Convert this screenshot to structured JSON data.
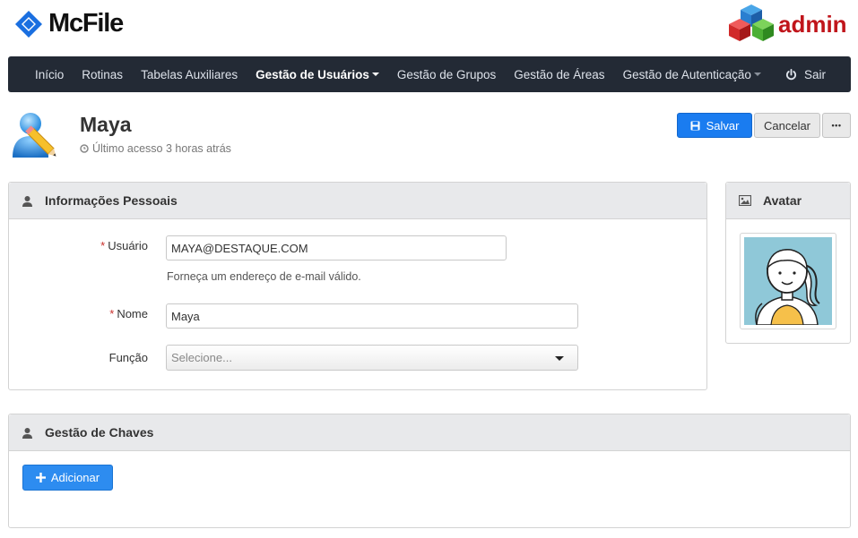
{
  "brand": {
    "name": "McFile",
    "admin_label": "admin"
  },
  "nav": {
    "items": [
      {
        "label": "Início",
        "active": false,
        "dropdown": false
      },
      {
        "label": "Rotinas",
        "active": false,
        "dropdown": false
      },
      {
        "label": "Tabelas Auxiliares",
        "active": false,
        "dropdown": false
      },
      {
        "label": "Gestão de Usuários",
        "active": true,
        "dropdown": true
      },
      {
        "label": "Gestão de Grupos",
        "active": false,
        "dropdown": false
      },
      {
        "label": "Gestão de Áreas",
        "active": false,
        "dropdown": false
      },
      {
        "label": "Gestão de Autenticação",
        "active": false,
        "dropdown": true
      }
    ],
    "logout_label": "Sair"
  },
  "user": {
    "name": "Maya",
    "last_access": "Último acesso 3 horas atrás"
  },
  "actions": {
    "save": "Salvar",
    "cancel": "Cancelar",
    "more": "•••"
  },
  "personal_panel": {
    "title": "Informações Pessoais",
    "required_mark": "*",
    "username_label": "Usuário",
    "username_value": "MAYA@DESTAQUE.COM",
    "username_help": "Forneça um endereço de e-mail válido.",
    "name_label": "Nome",
    "name_value": "Maya",
    "role_label": "Função",
    "role_placeholder": "Selecione..."
  },
  "avatar_panel": {
    "title": "Avatar"
  },
  "keys_panel": {
    "title": "Gestão de Chaves",
    "add_label": "Adicionar"
  },
  "colors": {
    "navbar": "#232a35",
    "primary": "#1a7cf0",
    "required": "#c9302c",
    "admin": "#c0151b"
  }
}
